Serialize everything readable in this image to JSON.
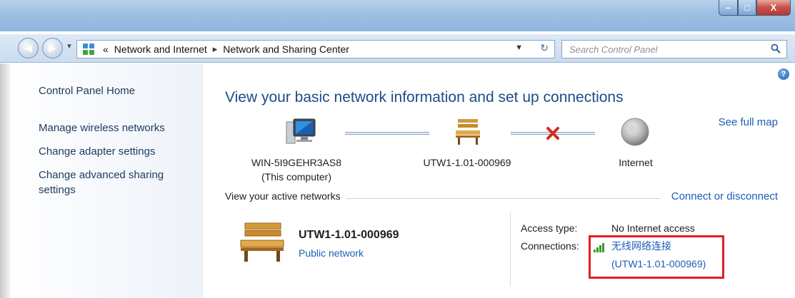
{
  "window": {
    "controls": {
      "minimize": "–",
      "maximize": "□",
      "close": "X"
    }
  },
  "nav": {
    "breadcrumb_prefix": "«",
    "breadcrumb": [
      "Network and Internet",
      "Network and Sharing Center"
    ],
    "separator": "▸",
    "search_placeholder": "Search Control Panel"
  },
  "sidebar": {
    "items": [
      {
        "label": "Control Panel Home"
      },
      {
        "label": "Manage wireless networks"
      },
      {
        "label": "Change adapter settings"
      },
      {
        "label": "Change advanced sharing"
      },
      {
        "label": "settings"
      }
    ]
  },
  "main": {
    "help_label": "?",
    "heading": "View your basic network information and set up connections",
    "see_full_map": "See full map",
    "nodes": {
      "computer_name": "WIN-5I9GEHR3AS8",
      "computer_sub": "(This computer)",
      "network_name": "UTW1-1.01-000969",
      "internet": "Internet"
    },
    "active_networks_label": "View your active networks",
    "connect_link": "Connect or disconnect",
    "active_network": {
      "name": "UTW1-1.01-000969",
      "type": "Public network",
      "access_type_label": "Access type:",
      "access_type_value": "No Internet access",
      "connections_label": "Connections:",
      "connection_line1": "无线网络连接",
      "connection_line2": "(UTW1-1.01-000969)"
    }
  },
  "colors": {
    "link": "#1a5fb4",
    "heading": "#1e4b88",
    "highlight": "#e0201d",
    "signal": "#3a9a2b"
  }
}
